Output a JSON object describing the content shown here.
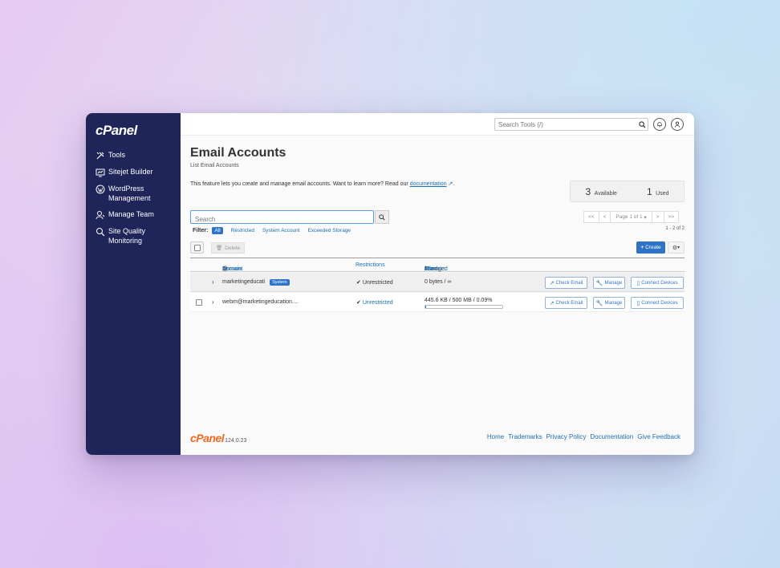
{
  "brand": {
    "logo": "cPanel",
    "version": "124.0.23"
  },
  "sidebar": {
    "items": [
      {
        "label": "Tools",
        "icon": "tools-icon"
      },
      {
        "label": "Sitejet Builder",
        "icon": "monitor-icon"
      },
      {
        "label": "WordPress Management",
        "icon": "wordpress-icon"
      },
      {
        "label": "Manage Team",
        "icon": "team-icon"
      },
      {
        "label": "Site Quality Monitoring",
        "icon": "search-monitor-icon"
      }
    ]
  },
  "topbar": {
    "search_placeholder": "Search Tools (/)",
    "icons": [
      "search-icon",
      "bell-icon",
      "user-icon"
    ]
  },
  "page": {
    "title": "Email Accounts",
    "breadcrumb": "List Email Accounts",
    "intro": "This feature lets you create and manage email accounts. Want to learn more? Read our",
    "intro_link": "documentation",
    "intro_end": "."
  },
  "stats": {
    "available_count": "3",
    "available_label": "Available",
    "used_count": "1",
    "used_label": "Used"
  },
  "list": {
    "search_placeholder": "Search",
    "filter_label": "Filter:",
    "filters": [
      "All",
      "Restricted",
      "System Account",
      "Exceeded Storage"
    ],
    "active_filter": "All",
    "pager": {
      "first": "<<",
      "prev": "<",
      "page": "Page 1 of 1",
      "next": ">",
      "last": ">>"
    },
    "range": "1 - 2 of 2",
    "delete_label": "Delete",
    "create_label": "Create",
    "headers": {
      "account": "Account",
      "at": "@",
      "domain": "Domain",
      "restrictions": "Restrictions",
      "storage": "Storage:",
      "used": "Used",
      "sep1": "/",
      "allocated": "Allocated",
      "sep2": "/",
      "percent": "%"
    },
    "rows": [
      {
        "account": "marketingeducati",
        "badge": "System",
        "restriction": "Unrestricted",
        "storage": "0 bytes / ∞",
        "actions": {
          "check": "Check Email",
          "manage": "Manage",
          "connect": "Connect Devices"
        }
      },
      {
        "account": "webm@marketingeducation....",
        "restriction": "Unrestricted",
        "storage": "445.6 KB / 500 MB / 0.09%",
        "usage_fraction": 0.0009,
        "actions": {
          "check": "Check Email",
          "manage": "Manage",
          "connect": "Connect Devices"
        }
      }
    ]
  },
  "footer": {
    "links": [
      "Home",
      "Trademarks",
      "Privacy Policy",
      "Documentation",
      "Give Feedback"
    ]
  },
  "colors": {
    "sidebar": "#1f2559",
    "accent": "#2f73c7",
    "brand_orange": "#f06a22",
    "link": "#1a6fb5"
  }
}
